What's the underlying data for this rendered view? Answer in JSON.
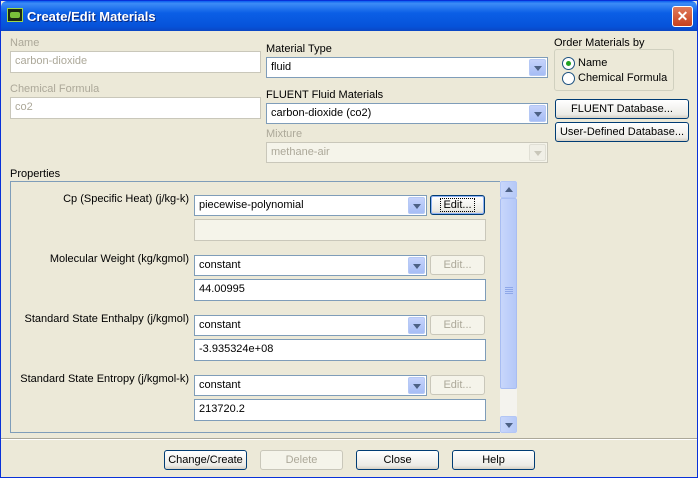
{
  "window": {
    "title": "Create/Edit Materials",
    "close_label": "✕"
  },
  "name": {
    "label": "Name",
    "value": "carbon-dioxide"
  },
  "chemical_formula": {
    "label": "Chemical Formula",
    "value": "co2"
  },
  "material_type": {
    "label": "Material Type",
    "value": "fluid"
  },
  "fluent_fluid_materials": {
    "label": "FLUENT Fluid Materials",
    "value": "carbon-dioxide (co2)"
  },
  "mixture": {
    "label": "Mixture",
    "value": "methane-air"
  },
  "order_by": {
    "label": "Order Materials by",
    "options": [
      "Name",
      "Chemical Formula"
    ],
    "selected": "Name"
  },
  "database_buttons": {
    "fluent": "FLUENT Database...",
    "user_defined": "User-Defined Database..."
  },
  "properties": {
    "label": "Properties",
    "rows": [
      {
        "label": "Cp (Specific Heat) (j/kg-k)",
        "method": "piecewise-polynomial",
        "edit": "Edit...",
        "edit_enabled": true,
        "value": ""
      },
      {
        "label": "Molecular Weight (kg/kgmol)",
        "method": "constant",
        "edit": "Edit...",
        "edit_enabled": false,
        "value": "44.00995"
      },
      {
        "label": "Standard State Enthalpy (j/kgmol)",
        "method": "constant",
        "edit": "Edit...",
        "edit_enabled": false,
        "value": "-3.935324e+08"
      },
      {
        "label": "Standard State Entropy (j/kgmol-k)",
        "method": "constant",
        "edit": "Edit...",
        "edit_enabled": false,
        "value": "213720.2"
      }
    ]
  },
  "footer": {
    "change_create": "Change/Create",
    "delete": "Delete",
    "close": "Close",
    "help": "Help"
  }
}
